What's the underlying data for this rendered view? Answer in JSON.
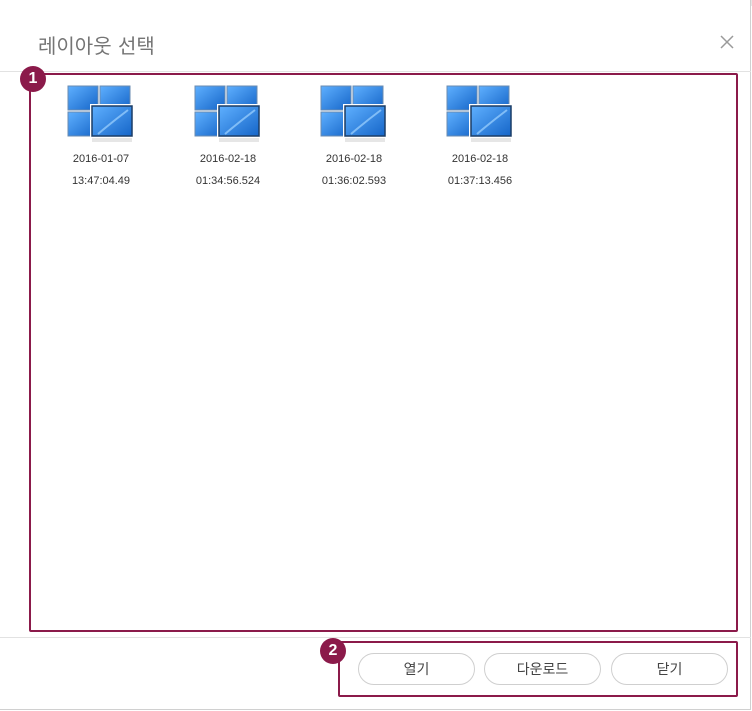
{
  "dialog": {
    "title": "레이아웃 선택",
    "close_icon": "close-icon"
  },
  "callouts": {
    "one": "1",
    "two": "2"
  },
  "layouts": [
    {
      "date": "2016-01-07",
      "time": "13:47:04.49",
      "icon": "layout-icon"
    },
    {
      "date": "2016-02-18",
      "time": "01:34:56.524",
      "icon": "layout-icon"
    },
    {
      "date": "2016-02-18",
      "time": "01:36:02.593",
      "icon": "layout-icon"
    },
    {
      "date": "2016-02-18",
      "time": "01:37:13.456",
      "icon": "layout-icon"
    }
  ],
  "footer": {
    "open_label": "열기",
    "download_label": "다운로드",
    "close_label": "닫기"
  },
  "colors": {
    "callout": "#8b1a4a",
    "icon_blue": "#1a73d9"
  }
}
